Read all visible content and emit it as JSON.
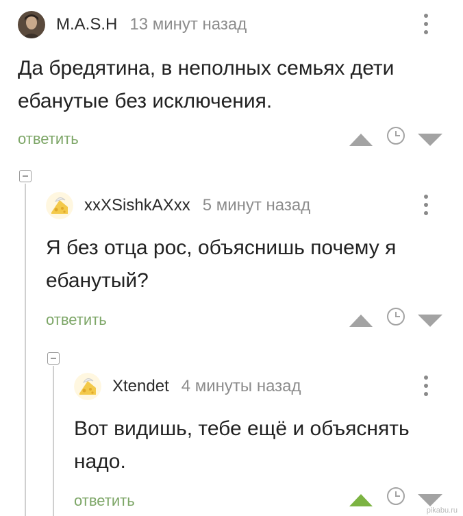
{
  "comments": [
    {
      "username": "M.A.S.H",
      "time": "13 минут назад",
      "text_line1": "Да бредятина, в неполных семьях дети",
      "text_line2": "ебанутые без исключения.",
      "reply_label": "ответить"
    },
    {
      "username": "xxXSishkAXxx",
      "time": "5 минут назад",
      "text_line1": "Я без отца рос, объяснишь почему я",
      "text_line2": "ебанутый?",
      "reply_label": "ответить"
    },
    {
      "username": "Xtendet",
      "time": "4 минуты назад",
      "text_line1": "Вот видишь, тебе ещё и объяснять",
      "text_line2": "надо.",
      "reply_label": "ответить",
      "upvoted": true
    }
  ],
  "colors": {
    "reply_green": "#7da667",
    "upvote_active": "#7cb342",
    "vote_gray": "#a3a3a3"
  },
  "watermark": "pikabu.ru"
}
